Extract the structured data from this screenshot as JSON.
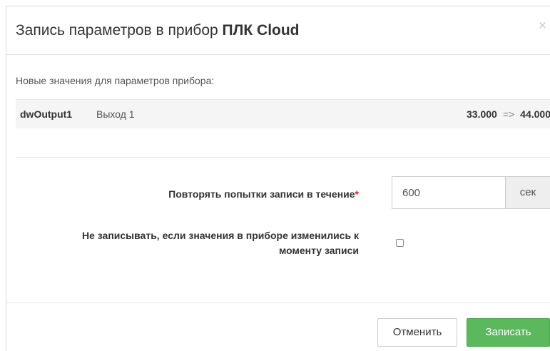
{
  "dialog": {
    "title_prefix": "Запись параметров в прибор",
    "device_name": "ПЛК Cloud",
    "close_symbol": "×"
  },
  "section": {
    "subtitle": "Новые значения для параметров прибора:"
  },
  "parameters": [
    {
      "name": "dwOutput1",
      "description": "Выход 1",
      "old_value": "33.000",
      "arrow": "=>",
      "new_value": "44.000"
    }
  ],
  "form": {
    "retry_label": "Повторять попытки записи в течение",
    "required_mark": "*",
    "retry_value": "600",
    "retry_unit": "сек",
    "no_write_label": "Не записывать, если значения в приборе изменились к моменту записи",
    "no_write_checked": false
  },
  "footer": {
    "cancel_label": "Отменить",
    "save_label": "Записать"
  },
  "colors": {
    "save_button": "#5cb85c",
    "required_mark": "#e02020"
  }
}
